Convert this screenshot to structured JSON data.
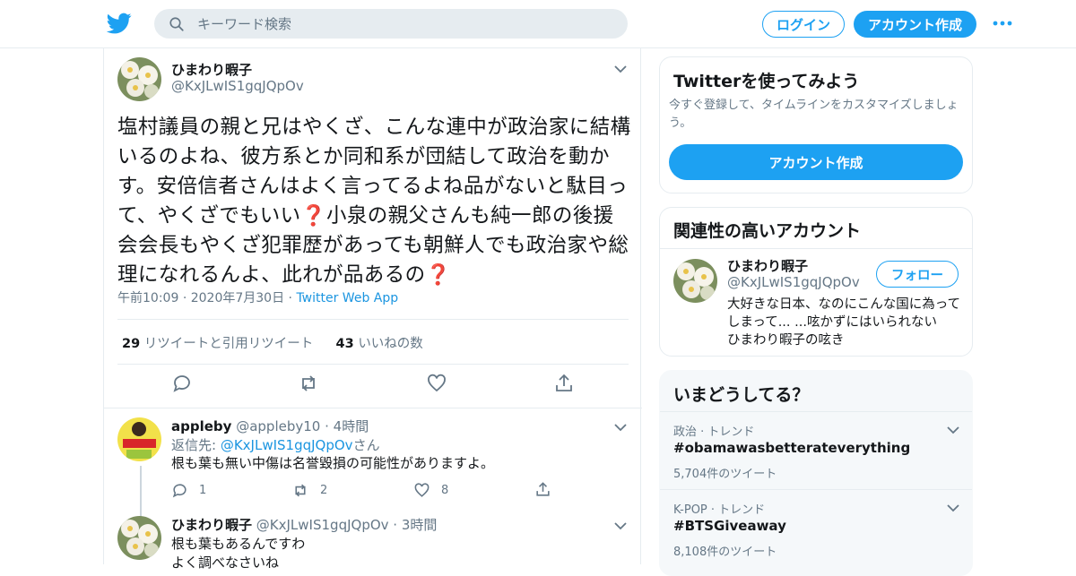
{
  "header": {
    "search_placeholder": "キーワード検索",
    "login_label": "ログイン",
    "signup_label": "アカウント作成",
    "brand_color": "#1da1f2"
  },
  "tweet": {
    "display_name": "ひまわり暇子",
    "handle": "@KxJLwIS1gqJQpOv",
    "text_part1": "塩村議員の親と兄はやくざ、こんな連中が政治家に結構いるのよね、彼方系とか同和系が団結して政治を動かす。安倍信者さんはよく言ってるよね品がないと駄目って、やくざでもいい",
    "text_emoji": "❓",
    "text_part2": "小泉の親父さんも純一郎の後援会会長もやくざ犯罪歴があっても朝鮮人でも政治家や総理になれるんよ、此れが品あるの",
    "time": "午前10:09",
    "date": "2020年7月30日",
    "source": "Twitter Web App",
    "retweets_count": "29",
    "retweets_label": "リツイートと引用リツイート",
    "likes_count": "43",
    "likes_label": "いいねの数"
  },
  "replies": [
    {
      "display_name": "appleby",
      "handle": "@appleby10",
      "time": "4時間",
      "reply_prefix": "返信先: ",
      "reply_to": "@KxJLwIS1gqJQpOv",
      "reply_suffix": "さん",
      "text": "根も葉も無い中傷は名誉毀損の可能性がありますよ。",
      "reply_count": "1",
      "retweet_count": "2",
      "like_count": "8"
    },
    {
      "display_name": "ひまわり暇子",
      "handle": "@KxJLwIS1gqJQpOv",
      "time": "3時間",
      "text_line1": "根も葉もあるんですわ",
      "text_line2": "よく調べなさいね"
    }
  ],
  "sidebar": {
    "signup_card": {
      "title": "Twitterを使ってみよう",
      "subtitle": "今すぐ登録して、タイムラインをカスタマイズしましょう。",
      "button": "アカウント作成"
    },
    "related": {
      "title": "関連性の高いアカウント",
      "display_name": "ひまわり暇子",
      "handle": "@KxJLwIS1gqJQpOv",
      "follow_label": "フォロー",
      "bio": "大好きな日本、なのにこんな国に為ってしまって... ...呟かずにはいられない　ひまわり暇子の呟き"
    },
    "trends": {
      "title": "いまどうしてる？",
      "items": [
        {
          "category": "政治 · トレンド",
          "tag": "#obamawasbetterateverything",
          "count": "5,704件のツイート"
        },
        {
          "category": "K-POP · トレンド",
          "tag": "#BTSGiveaway",
          "count": "8,108件のツイート"
        }
      ]
    }
  }
}
